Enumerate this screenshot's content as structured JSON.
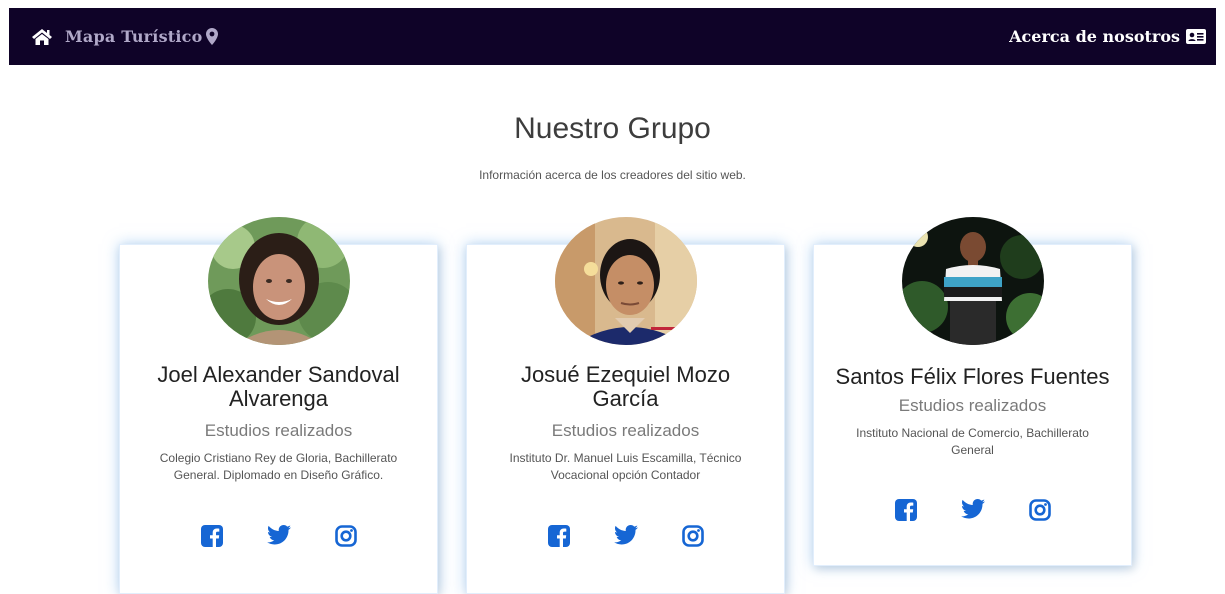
{
  "nav": {
    "brand": "Mapa Turístico",
    "about": "Acerca de nosotros"
  },
  "header": {
    "title": "Nuestro Grupo",
    "subtitle": "Información acerca de los creadores del sitio web."
  },
  "members": [
    {
      "name_line1": "Joel Alexander Sandoval",
      "name_line2": "Alvarenga",
      "studies": "Estudios realizados",
      "desc_line1": "Colegio Cristiano Rey de Gloria, Bachillerato",
      "desc_line2": "General. Diplomado en Diseño Gráfico."
    },
    {
      "name_line1": "Josué Ezequiel Mozo",
      "name_line2": "García",
      "studies": "Estudios realizados",
      "desc_line1": "Instituto Dr. Manuel Luis Escamilla, Técnico",
      "desc_line2": "Vocacional opción Contador"
    },
    {
      "name_line1": "Santos Félix Flores Fuentes",
      "studies": "Estudios realizados",
      "desc_line1": "Instituto Nacional de Comercio, Bachillerato",
      "desc_line2": "General"
    }
  ],
  "icons": [
    "home-icon",
    "map-marker-icon",
    "id-card-icon",
    "facebook-icon",
    "twitter-icon",
    "instagram-icon"
  ],
  "colors": {
    "navbar": "#0f0328",
    "social": "#1666d4",
    "card_glow": "#78b4f0"
  }
}
